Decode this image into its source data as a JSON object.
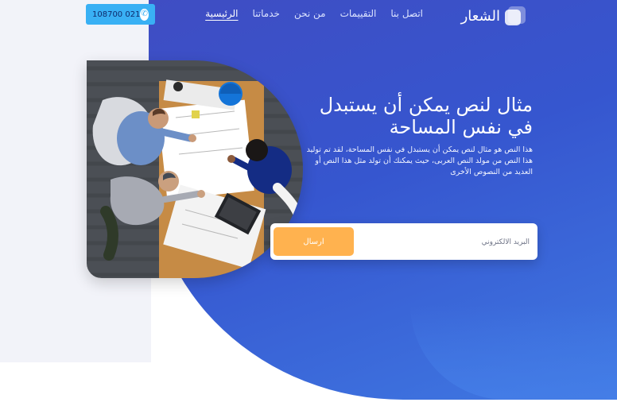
{
  "header": {
    "phone": "108700 021",
    "logo_text": "الشعار",
    "nav": [
      {
        "label": "الرئيسية",
        "active": true
      },
      {
        "label": "خدماتنا",
        "active": false
      },
      {
        "label": "من نحن",
        "active": false
      },
      {
        "label": "التقييمات",
        "active": false
      },
      {
        "label": "اتصل بنا",
        "active": false
      }
    ]
  },
  "hero": {
    "title_line1": "مثال لنص يمكن أن يستبدل",
    "title_line2": "في نفس المساحة",
    "description": "هذا النص هو مثال لنص يمكن أن يستبدل في نفس المساحة، لقد تم توليد هذا النص من مولد النص العربى، حيث يمكنك أن تولد مثل هذا النص أو العديد من النصوص الأخرى"
  },
  "subscribe": {
    "email_placeholder": "البريد الالكتروني",
    "send_label": "ارسال"
  },
  "colors": {
    "hero_gradient_start": "#3f4dc3",
    "hero_gradient_end": "#3f78e2",
    "phone_button": "#39b0f4",
    "send_button": "#ffb24f",
    "left_panel": "#f2f3f9"
  },
  "icons": {
    "phone": "phone-icon",
    "logo": "logo-icon"
  }
}
